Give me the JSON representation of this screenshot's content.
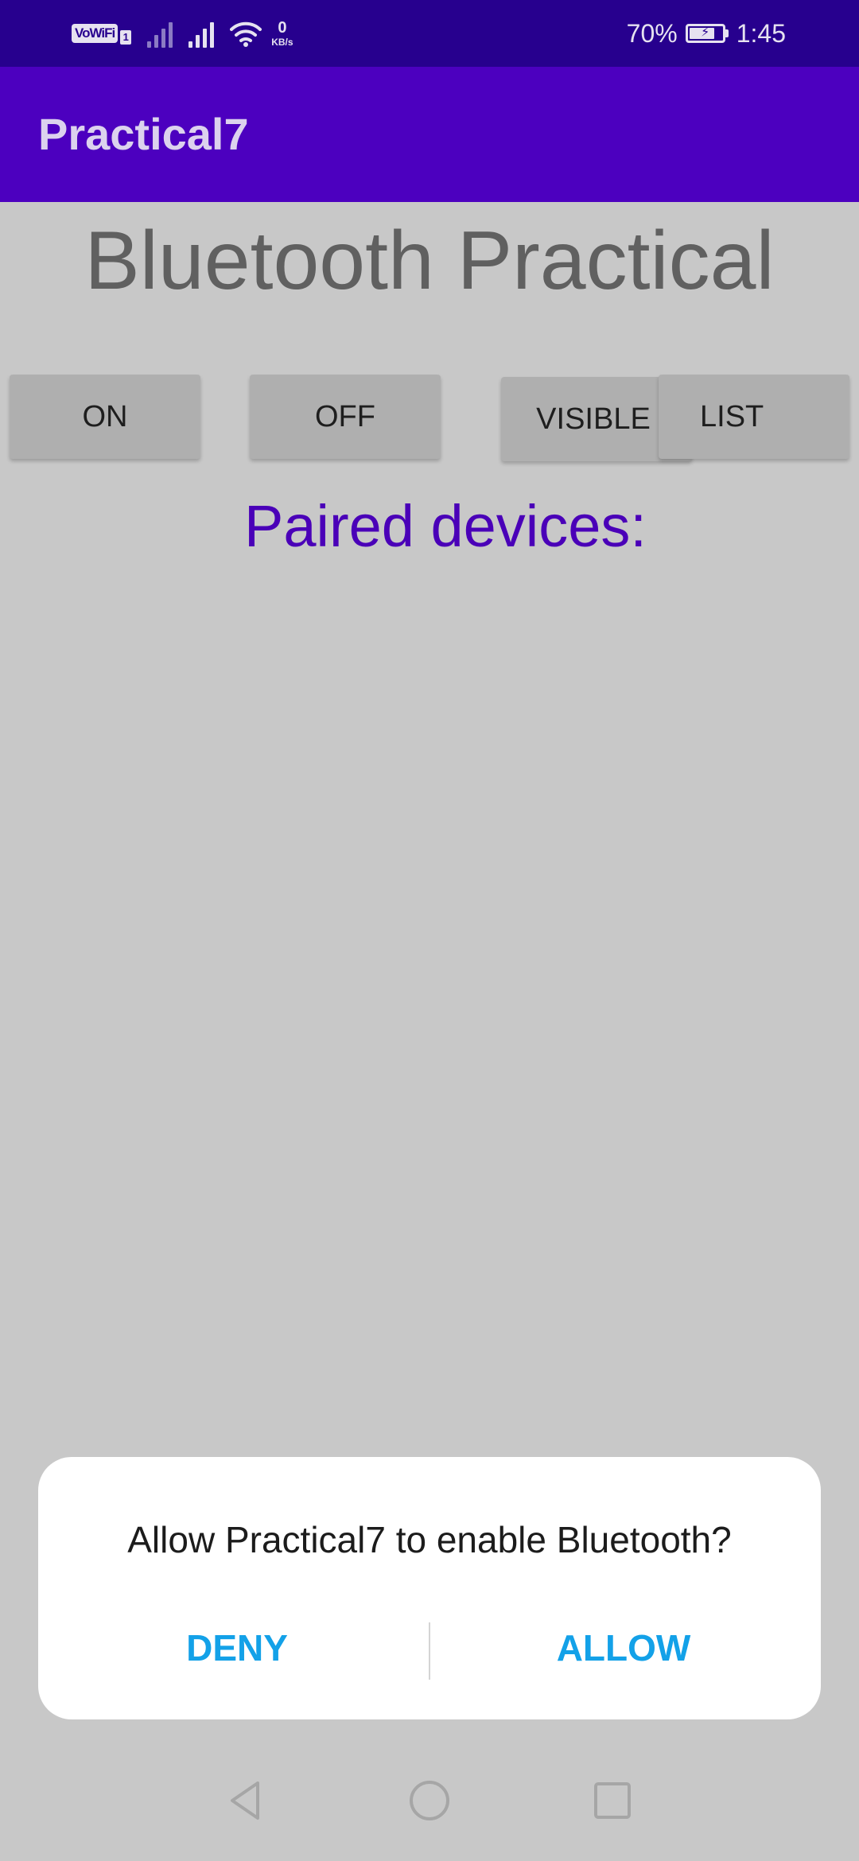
{
  "status_bar": {
    "vowifi_label": "VoWiFi",
    "sim_label": "1",
    "net_speed_value": "0",
    "net_speed_unit": "KB/s",
    "battery_percent": "70%",
    "battery_level": 0.7,
    "time": "1:45",
    "colors": {
      "background": "#27008e",
      "foreground": "#e6e2f0"
    }
  },
  "app_bar": {
    "title": "Practical7",
    "color": "#4c00bf"
  },
  "main": {
    "heading": "Bluetooth Practical",
    "buttons": [
      {
        "id": "on",
        "label": "ON"
      },
      {
        "id": "off",
        "label": "OFF"
      },
      {
        "id": "visible",
        "label": "VISIBLE"
      },
      {
        "id": "list",
        "label": "LIST"
      }
    ],
    "paired_label": "Paired devices:",
    "paired_label_color": "#4a00b8",
    "scrim_color": "#c8c8c8"
  },
  "dialog": {
    "message": "Allow Practical7 to enable Bluetooth?",
    "deny_label": "DENY",
    "allow_label": "ALLOW",
    "action_color": "#13a1e8"
  },
  "nav_bar": {
    "icons": [
      "back-icon",
      "home-icon",
      "recent-apps-icon"
    ]
  }
}
